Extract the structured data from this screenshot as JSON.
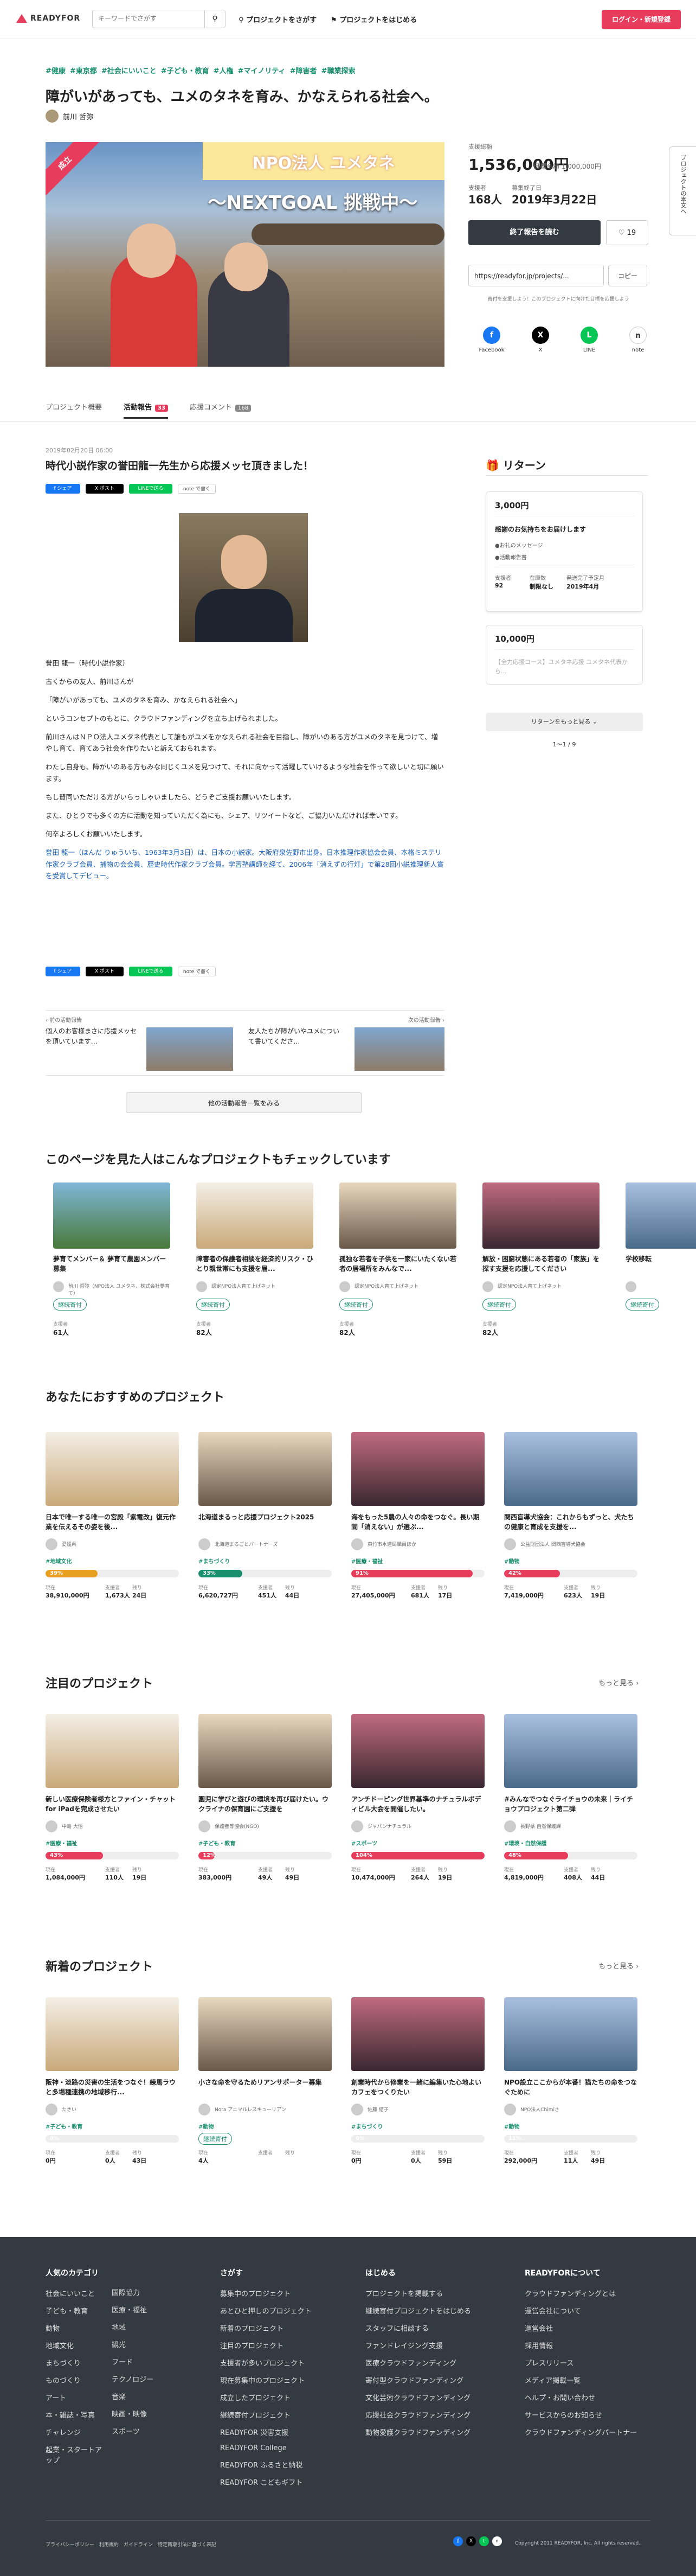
{
  "header": {
    "logo": "READYFOR",
    "search_placeholder": "キーワードでさがす",
    "nav_search": "プロジェクトをさがす",
    "nav_start": "プロジェクトをはじめる",
    "login": "ログイン・新規登録"
  },
  "project": {
    "tags": [
      "#健康",
      "#東京都",
      "#社会にいいこと",
      "#子ども・教育",
      "#人権",
      "#マイノリティ",
      "#障害者",
      "#職業探索"
    ],
    "title": "障がいがあっても、ユメのタネを育み、かなえられる社会へ。",
    "owner": "前川 哲弥",
    "badge": "成立",
    "image_banner_top": "NPO法人 ユメタネ",
    "image_banner_main": "〜NEXTGOAL 挑戦中〜",
    "amount_label": "支援総額",
    "amount": "1,536,000円",
    "target_label": "目標金額",
    "target": "1,000,000円",
    "supporters_label": "支援者",
    "supporters": "168人",
    "end_label": "募集終了日",
    "end_date": "2019年3月22日",
    "ended_button": "終了報告を読む",
    "like_count": "19",
    "url": "https://readyfor.jp/projects/...",
    "copy": "コピー",
    "share_note": "寄付を支援しよう！このプロジェクトに向けた目標を応援しよう",
    "share": [
      "Facebook",
      "X",
      "LINE",
      "note"
    ],
    "side_label": "プロジェクトの本文へ"
  },
  "tabs": [
    {
      "label": "プロジェクト概要",
      "count": ""
    },
    {
      "label": "活動報告",
      "count": "33"
    },
    {
      "label": "応援コメント",
      "count": "168"
    }
  ],
  "report": {
    "date": "2019年02月20日 06:00",
    "title": "時代小説作家の誉田龍一先生から応援メッセ頂きました！",
    "share_buttons": [
      "f シェア",
      "X ポスト",
      "LINEで送る",
      "note で書く"
    ],
    "paragraphs": [
      "誉田 龍一（時代小説作家）",
      "古くからの友人、前川さんが",
      "「障がいがあっても、ユメのタネを育み、かなえられる社会へ」",
      "というコンセプトのもとに、クラウドファンディングを立ち上げられました。",
      "前川さんはＮＰＯ法人ユメタネ代表として誰もがユメをかなえられる社会を目指し、障がいのある方がユメのタネを見つけて、増やし育て、育てあう社会を作りたいと訴えておられます。",
      "わたし自身も、障がいのある方もみな同じくユメを見つけて、それに向かって活躍していけるような社会を作って欲しいと切に願います。",
      "もし賛同いただける方がいらっしゃいましたら、どうぞご支援お願いいたします。",
      "また、ひとりでも多くの方に活動を知っていただく為にも、シェア、リツイートなど、ご協力いただければ幸いです。",
      "何卒よろしくお願いいたします。",
      "誉田 龍一（ほんだ りゅういち、1963年3月3日）は、日本の小説家。大阪府泉佐野市出身。日本推理作家協会会員、本格ミステリ作家クラブ会員、捕物の会会員、歴史時代作家クラブ会員。学習塾講師を経て、2006年「消えずの行灯」で第28回小説推理新人賞を受賞してデビュー。"
    ],
    "prev_label": "前の活動報告",
    "prev_title": "個人のお客様まさに応援メッセを頂いています…",
    "next_label": "次の活動報告",
    "next_title": "友人たちが障がいやユメについて書いてくださ…",
    "all_reports": "他の活動報告一覧をみる"
  },
  "returns": {
    "title": "リターン",
    "items": [
      {
        "price": "3,000円",
        "desc": "感謝のお気持ちをお届けします",
        "line1": "●お礼のメッセージ",
        "line2": "●活動報告書",
        "s_label": "支援者",
        "s_val": "92",
        "stock_label": "在庫数",
        "stock_val": "制限なし",
        "deliv_label": "発送完了予定月",
        "deliv_val": "2019年4月"
      },
      {
        "price": "10,000円",
        "desc": "【全力応援コース】ユメタネ応援 ユメタネ代表から...",
        "line1": "",
        "line2": "",
        "s_label": "",
        "s_val": "",
        "stock_label": "",
        "stock_val": "",
        "deliv_label": "",
        "deliv_val": ""
      }
    ],
    "more": "リターンをもっと見る",
    "pager": "1〜1 / 9"
  },
  "also_viewed": {
    "title": "このページを見た人はこんなプロジェクトもチェックしています",
    "items": [
      {
        "title": "夢育てメンバー＆ 夢育て農園メンバー募集",
        "owner": "前川 哲弥（NPO法人 ユメタネ、株式会社夢育て）",
        "pill": "継続寄付",
        "l": "支援者",
        "v": "61人"
      },
      {
        "title": "障害者の保護者相談を経済的リスク・ひとり親世帯にも支援を届...",
        "owner": "認定NPO法人育て上げネット",
        "pill": "継続寄付",
        "l": "支援者",
        "v": "82人"
      },
      {
        "title": "孤独な若者を子供を一家にいたくない若者の居場所をみんなで...",
        "owner": "認定NPO法人育て上げネット",
        "pill": "継続寄付",
        "l": "支援者",
        "v": "82人"
      },
      {
        "title": "解放・困窮状態にある若者の「家族」を探す支援を応援してください",
        "owner": "認定NPO法人育て上げネット",
        "pill": "継続寄付",
        "l": "支援者",
        "v": "82人"
      },
      {
        "title": "学校移転",
        "owner": "",
        "pill": "継続寄付",
        "l": "",
        "v": ""
      }
    ]
  },
  "recommended": {
    "title": "あなたにおすすめのプロジェクト",
    "items": [
      {
        "title": "日本で唯一する唯一の宮殿「紫電改」復元作業を伝えるその姿を後...",
        "owner": "愛媛県",
        "tag": "#地域文化",
        "pct": "39%",
        "pctv": 39,
        "color": "#e8a020",
        "amount": "38,910,000円",
        "sup": "1,673人",
        "days": "24日"
      },
      {
        "title": "北海道まるっと応援プロジェクト2025",
        "owner": "北海道まるごとパートナーズ",
        "tag": "#まちづくり",
        "pct": "33%",
        "pctv": 33,
        "color": "#1a8f6d",
        "amount": "6,620,727円",
        "sup": "451人",
        "days": "44日"
      },
      {
        "title": "海をもった5農の人々の命をつなぐ。長い期間「消えない」が選ぶ...",
        "owner": "東竹市水道局職員ほか",
        "tag": "#医療・福祉",
        "pct": "91%",
        "pctv": 91,
        "color": "#e83c5c",
        "amount": "27,405,000円",
        "sup": "681人",
        "days": "17日"
      },
      {
        "title": "関西盲導犬協会：これからもずっと、犬たちの健康と育成を支援を...",
        "owner": "公益財団法人 関西盲導犬協会",
        "tag": "#動物",
        "pct": "42%",
        "pctv": 42,
        "color": "#e83c5c",
        "amount": "7,419,000円",
        "sup": "623人",
        "days": "19日"
      }
    ]
  },
  "featured": {
    "title": "注目のプロジェクト",
    "more": "もっと見る",
    "items": [
      {
        "title": "新しい医療保険者様方とファイン・チャットfor iPadを完成させたい",
        "owner": "中島 大悟",
        "tag": "#医療・福祉",
        "pct": "43%",
        "pctv": 43,
        "color": "#e83c5c",
        "amount": "1,084,000円",
        "sup": "110人",
        "days": "19日"
      },
      {
        "title": "園児に学びと遊びの環境を再び届けたい。ウクライナの保育園にご支援を",
        "owner": "保護者等協会(NGO)",
        "tag": "#子ども・教育",
        "pct": "12%",
        "pctv": 12,
        "color": "#e83c5c",
        "amount": "383,000円",
        "sup": "49人",
        "days": "49日"
      },
      {
        "title": "アンチドーピング世界基準のナチュラルボディビル大会を開催したい。",
        "owner": "ジャパンナチュラル",
        "tag": "#スポーツ",
        "pct": "104%",
        "pctv": 100,
        "color": "#e83c5c",
        "amount": "10,474,000円",
        "sup": "264人",
        "days": "19日"
      },
      {
        "title": "#みんなでつなぐライチョウの未来｜ライチョウプロジェクト第二弾",
        "owner": "長野県 自然保護課",
        "tag": "#環境・自然保護",
        "pct": "48%",
        "pctv": 48,
        "color": "#e83c5c",
        "amount": "4,819,000円",
        "sup": "408人",
        "days": "44日"
      }
    ]
  },
  "newest": {
    "title": "新着のプロジェクト",
    "more": "もっと見る",
    "items": [
      {
        "title": "阪神・淡路の災害の生活をつなぐ！練馬ラウと多場種連携の地域移行...",
        "owner": "たきい",
        "tag": "#子ども・教育",
        "pct": "0%",
        "amount": "0円",
        "sup": "0人",
        "days": "43日",
        "pill": ""
      },
      {
        "title": "小さな命を守るためリアンサポーター募集",
        "owner": "Nora アニマルレスキューリアン",
        "tag": "#動物",
        "pct": "",
        "amount": "4人",
        "sup": "",
        "days": "",
        "pill": "継続寄付"
      },
      {
        "title": "創業時代から修業を一緒に編集いた心地よいカフェをつくりたい",
        "owner": "佐藤 結子",
        "tag": "#まちづくり",
        "pct": "0%",
        "amount": "0円",
        "sup": "0人",
        "days": "59日",
        "pill": ""
      },
      {
        "title": "NPO設立ここからが本番！猫たちの命をつなぐために",
        "owner": "NPO法人Chimiさ",
        "tag": "#動物",
        "pct": "11%",
        "amount": "292,000円",
        "sup": "11人",
        "days": "49日",
        "pill": ""
      }
    ]
  },
  "footer": {
    "col1_title": "人気のカテゴリ",
    "col1a": [
      "社会にいいこと",
      "子ども・教育",
      "動物",
      "地域文化",
      "まちづくり",
      "ものづくり",
      "アート",
      "本・雑誌・写真",
      "チャレンジ",
      "起業・スタートアップ"
    ],
    "col1b": [
      "国際協力",
      "医療・福祉",
      "地域",
      "観光",
      "フード",
      "テクノロジー",
      "音楽",
      "映画・映像",
      "スポーツ"
    ],
    "col2_title": "さがす",
    "col2": [
      "募集中のプロジェクト",
      "あとひと押しのプロジェクト",
      "新着のプロジェクト",
      "注目のプロジェクト",
      "支援者が多いプロジェクト",
      "現在募集中のプロジェクト",
      "成立したプロジェクト",
      "継続寄付プロジェクト",
      "READYFOR 災害支援",
      "READYFOR College",
      "READYFOR ふるさと納税",
      "READYFOR こどもギフト"
    ],
    "col3_title": "はじめる",
    "col3": [
      "プロジェクトを掲載する",
      "継続寄付プロジェクトをはじめる",
      "スタッフに相談する",
      "ファンドレイジング支援",
      "医療クラウドファンディング",
      "寄付型クラウドファンディング",
      "文化芸術クラウドファンディング",
      "応援社会クラウドファンディング",
      "動物愛護クラウドファンディング"
    ],
    "col4_title": "READYFORについて",
    "col4": [
      "クラウドファンディングとは",
      "運営会社について",
      "運営会社",
      "採用情報",
      "プレスリリース",
      "メディア掲載一覧",
      "ヘルプ・お問い合わせ",
      "サービスからのお知らせ",
      "クラウドファンディングパートナー"
    ],
    "bottom_links": "プライバシーポリシー　利用規約　ガイドライン　特定商取引法に基づく表記",
    "copyright": "Copyright 2011 READYFOR, Inc. All rights reserved."
  },
  "colors": {
    "brand": "#e83c5c",
    "green": "#1a8f6d",
    "dark": "#333a42"
  }
}
